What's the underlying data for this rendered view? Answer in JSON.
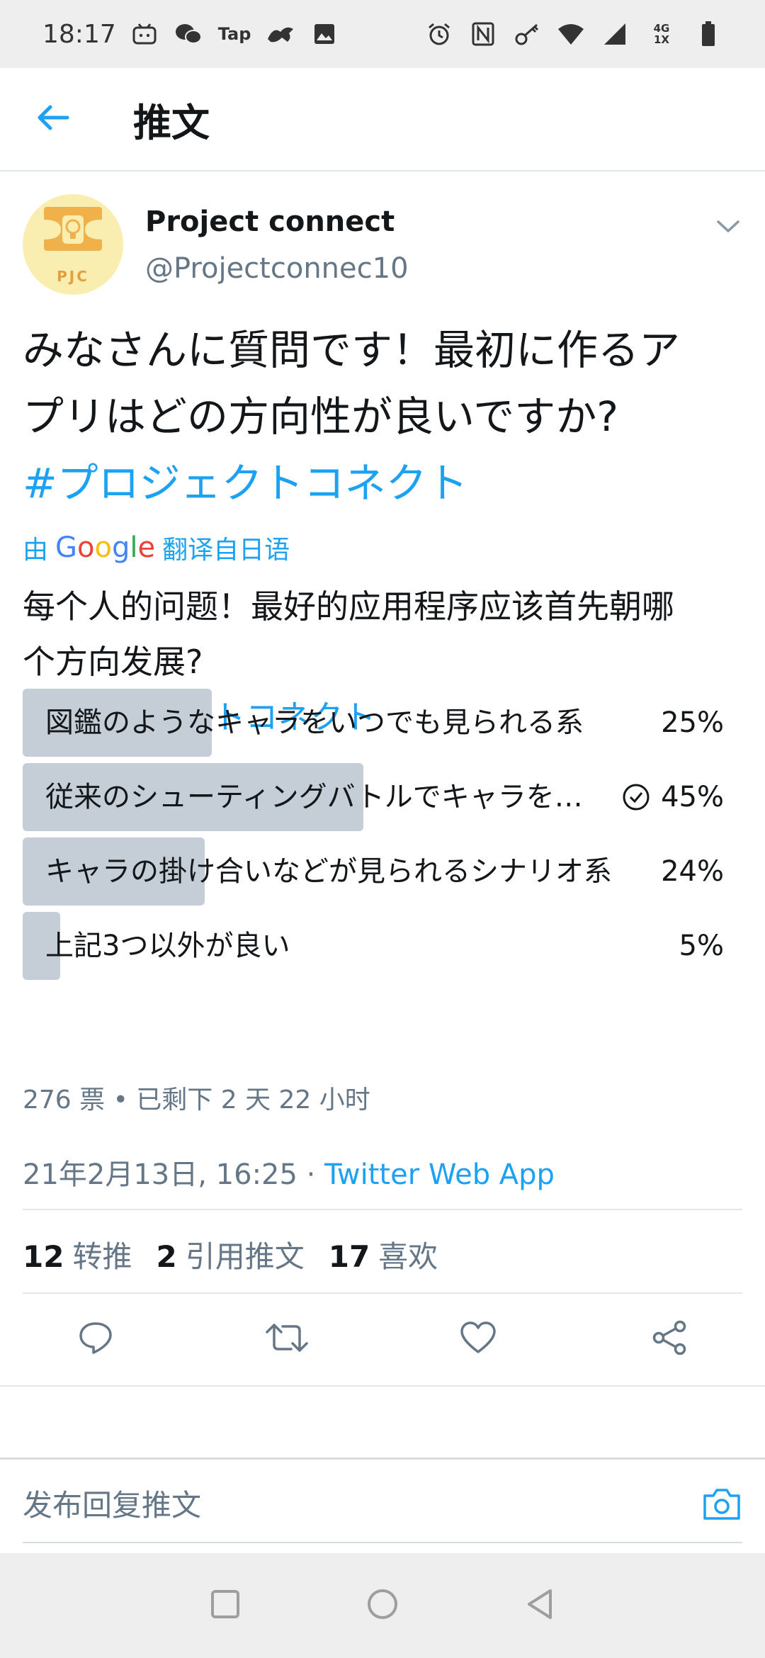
{
  "status_bar": {
    "time": "18:17",
    "left_icons": [
      "bilibili-icon",
      "wechat-icon",
      "taptap-icon",
      "dragon-app-icon",
      "gallery-icon"
    ],
    "taptap_text": "Tap",
    "right_icons": [
      "alarm-icon",
      "nfc-icon",
      "key-icon",
      "wifi-icon",
      "signal-icon",
      "network-4g-icon",
      "battery-icon"
    ],
    "network_top": "4G",
    "network_bottom": "1X"
  },
  "header": {
    "back_icon": "arrow-left-icon",
    "title": "推文"
  },
  "tweet": {
    "author_name": "Project connect",
    "author_handle": "@Projectconnec10",
    "avatar_text": "PJC",
    "text_line1": "みなさんに質問です！最初に作るア",
    "text_line2": "プリはどの方向性が良いですか?",
    "hashtag": "#プロジェクトコネクト",
    "translate_prefix": "由",
    "translate_suffix": "翻译自日语",
    "google_letters": [
      "G",
      "o",
      "o",
      "g",
      "l",
      "e"
    ],
    "translated_line1": "每个人的问题！最好的应用程序应该首先朝哪",
    "translated_line2": "个方向发展?",
    "translated_hashtag": "#プロジェクトコネクト"
  },
  "poll": {
    "options": [
      {
        "label": "図鑑のようなキャラをいつでも見られる系",
        "percent_text": "25%",
        "percent": 25
      },
      {
        "label": "従来のシューティングバトルでキャラを…",
        "percent_text": "45%",
        "percent": 45,
        "selected": true
      },
      {
        "label": "キャラの掛け合いなどが見られるシナリオ系",
        "percent_text": "24%",
        "percent": 24
      },
      {
        "label": "上記3つ以外が良い",
        "percent_text": "5%",
        "percent": 5
      }
    ],
    "meta": "276 票 • 已剩下 2 天 22 小时"
  },
  "timestamp": {
    "date": "21年2月13日, 16:25 · ",
    "via": "Twitter Web App"
  },
  "stats": {
    "retweets_count": "12",
    "retweets_label": "转推",
    "quotes_count": "2",
    "quotes_label": "引用推文",
    "likes_count": "17",
    "likes_label": "喜欢"
  },
  "actions": [
    "reply-icon",
    "retweet-icon",
    "like-icon",
    "share-icon"
  ],
  "reply_bar": {
    "placeholder": "发布回复推文",
    "camera_icon": "camera-icon"
  },
  "nav_bar": [
    "recents-square-icon",
    "home-circle-icon",
    "back-triangle-icon"
  ],
  "colors": {
    "accent": "#1da1f2",
    "text": "#14171a",
    "secondary": "#657786",
    "poll_bar": "#c5ced6",
    "avatar_bg": "#faedb0",
    "avatar_logo": "#f0b04a"
  }
}
